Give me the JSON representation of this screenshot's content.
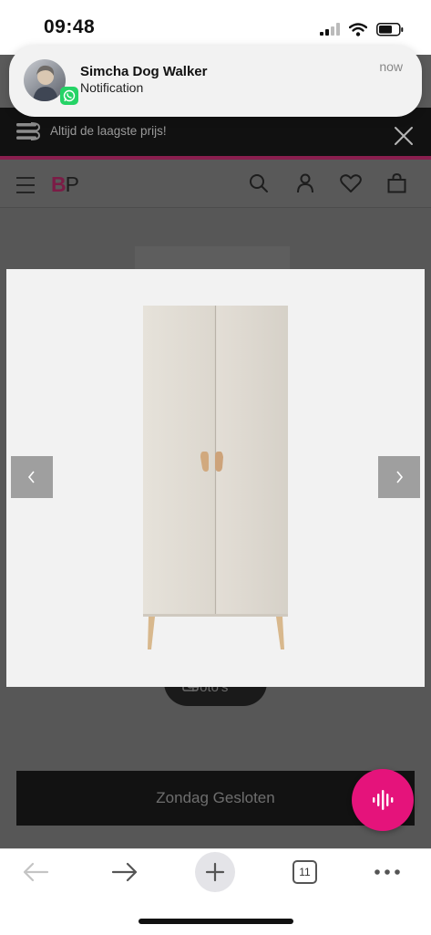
{
  "status_bar": {
    "time": "09:48"
  },
  "notification": {
    "title": "Simcha Dog Walker",
    "body": "Notification",
    "time": "now",
    "app_icon": "whatsapp-icon"
  },
  "promo_bar": {
    "text": "Altijd de laagste prijs!",
    "close_icon": "close-icon"
  },
  "header": {
    "logo": {
      "bold": "B",
      "light": "P"
    },
    "icons": [
      "menu-icon",
      "search-icon",
      "account-icon",
      "heart-icon",
      "cart-icon"
    ],
    "accent_color": "#8a1f4f"
  },
  "gallery": {
    "prev_icon": "chevron-left-icon",
    "next_icon": "chevron-right-icon",
    "product": "wardrobe",
    "photo_button_label": "Foto's"
  },
  "store_banner": {
    "text": "Zondag Gesloten"
  },
  "fab": {
    "icon": "voice-wave-icon",
    "color": "#e5137b"
  },
  "browser_bar": {
    "tab_count": "11",
    "icons": [
      "back-arrow-icon",
      "forward-arrow-icon",
      "new-tab-icon",
      "tabs-icon",
      "more-icon"
    ]
  }
}
